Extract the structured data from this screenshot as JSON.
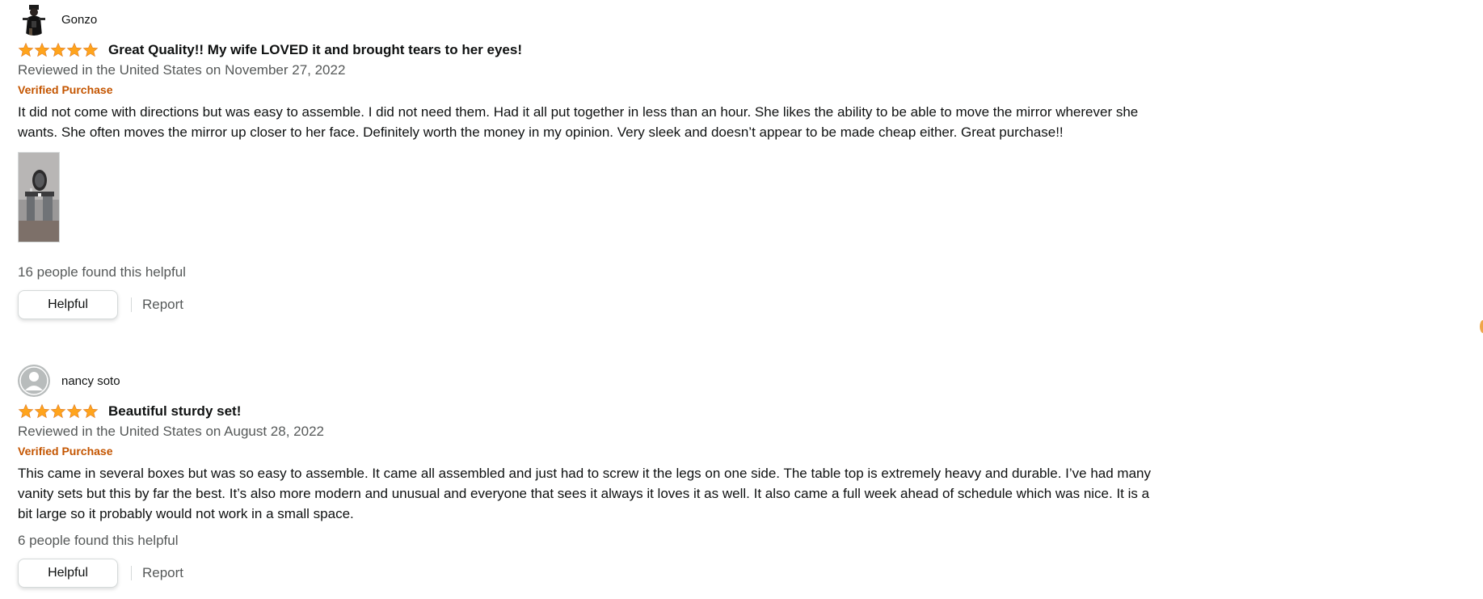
{
  "colors": {
    "star": "#ffa41c",
    "verified": "#c45500",
    "muted_text": "#565959",
    "primary_text": "#0f1111"
  },
  "reviews": [
    {
      "profile_name": "Gonzo",
      "avatar": "user-photo",
      "rating": 5,
      "title": "Great Quality!! My wife LOVED it and brought tears to her eyes!",
      "date": "Reviewed in the United States on November 27, 2022",
      "verified": "Verified Purchase",
      "body": "It did not come with directions but was easy to assemble. I did not need them. Had it all put together in less than an hour. She likes the ability to be able to move the mirror wherever she wants. She often moves the mirror up closer to her face. Definitely worth the money in my opinion. Very sleek and doesn’t appear to be made cheap either. Great purchase!!",
      "has_image": true,
      "helpful_count": "16 people found this helpful",
      "helpful_label": "Helpful",
      "report_label": "Report"
    },
    {
      "profile_name": "nancy soto",
      "avatar": "default-user-icon",
      "rating": 5,
      "title": "Beautiful sturdy set!",
      "date": "Reviewed in the United States on August 28, 2022",
      "verified": "Verified Purchase",
      "body": "This came in several boxes but was so easy to assemble. It came all assembled and just had to screw it the legs on one side. The table top is extremely heavy and durable. I’ve had many vanity sets but this by far the best. It’s also more modern and unusual and everyone that sees it always it loves it as well. It also came a full week ahead of schedule which was nice. It is a bit large so it probably would not work in a small space.",
      "has_image": false,
      "helpful_count": "6 people found this helpful",
      "helpful_label": "Helpful",
      "report_label": "Report"
    }
  ]
}
